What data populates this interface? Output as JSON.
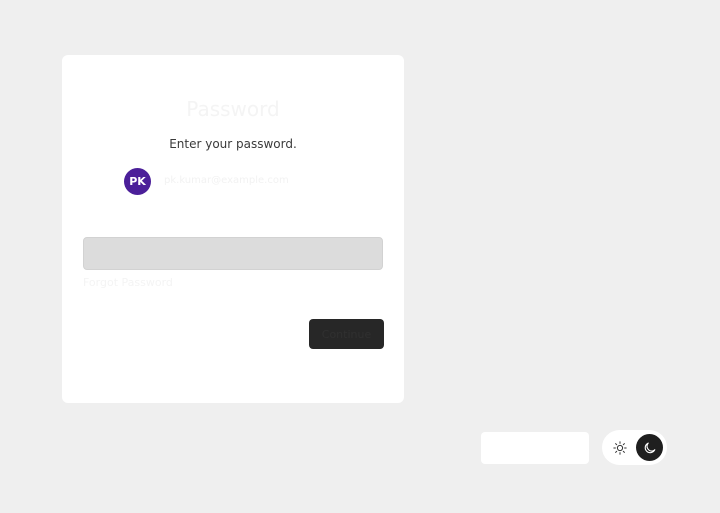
{
  "card": {
    "title": "Password",
    "subtitle": "Enter your password.",
    "avatar_initials": "PK",
    "email": "pk.kumar@example.com",
    "password_placeholder": "",
    "forgot_link": "Forgot Password",
    "continue_label": "Continue"
  },
  "theme_toggle": {
    "light_icon": "sun-icon",
    "dark_icon": "moon-icon",
    "selected": "dark"
  },
  "colors": {
    "avatar": "#4b1f99",
    "continue_button": "#272727",
    "input_bg": "#dcdcdc"
  }
}
